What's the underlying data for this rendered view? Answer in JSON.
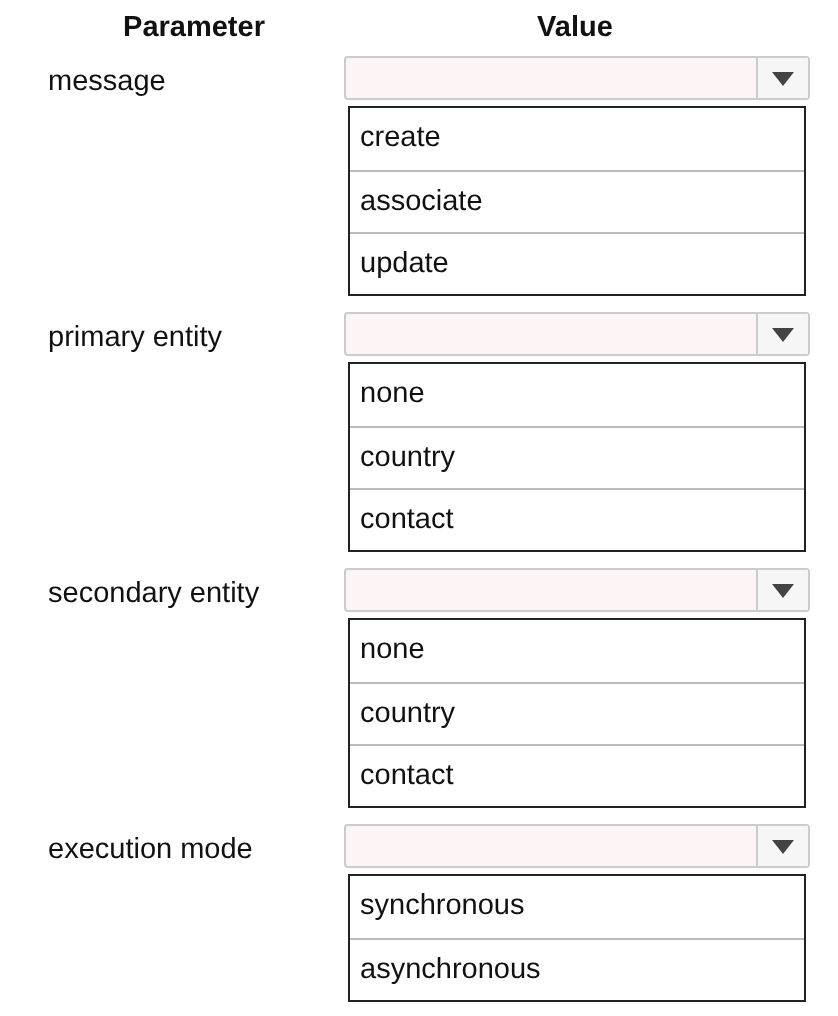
{
  "columns": [
    "Parameter",
    "Value"
  ],
  "parameters": [
    {
      "label": "message",
      "options": [
        "create",
        "associate",
        "update"
      ]
    },
    {
      "label": "primary entity",
      "options": [
        "none",
        "country",
        "contact"
      ]
    },
    {
      "label": "secondary entity",
      "options": [
        "none",
        "country",
        "contact"
      ]
    },
    {
      "label": "execution mode",
      "options": [
        "synchronous",
        "asynchronous"
      ]
    }
  ]
}
